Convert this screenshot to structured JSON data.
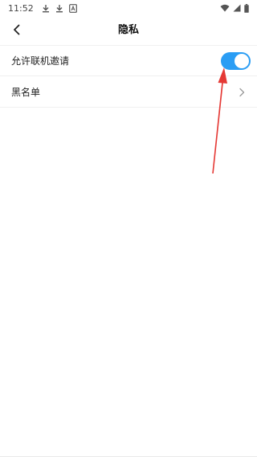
{
  "status_bar": {
    "time": "11:52",
    "left_icons": [
      "download-icon",
      "download-icon",
      "notification-app-icon"
    ],
    "right_icons": [
      "wifi-icon",
      "signal-icon",
      "battery-icon"
    ]
  },
  "header": {
    "title": "隐私",
    "back_icon": "chevron-left-icon"
  },
  "settings": {
    "invite": {
      "label": "允许联机邀请",
      "toggle_on": true
    },
    "blacklist": {
      "label": "黑名单",
      "chevron_icon": "chevron-right-icon"
    }
  },
  "colors": {
    "accent": "#2a9df4",
    "annotation_arrow": "#e53935",
    "background": "#ffffff"
  }
}
